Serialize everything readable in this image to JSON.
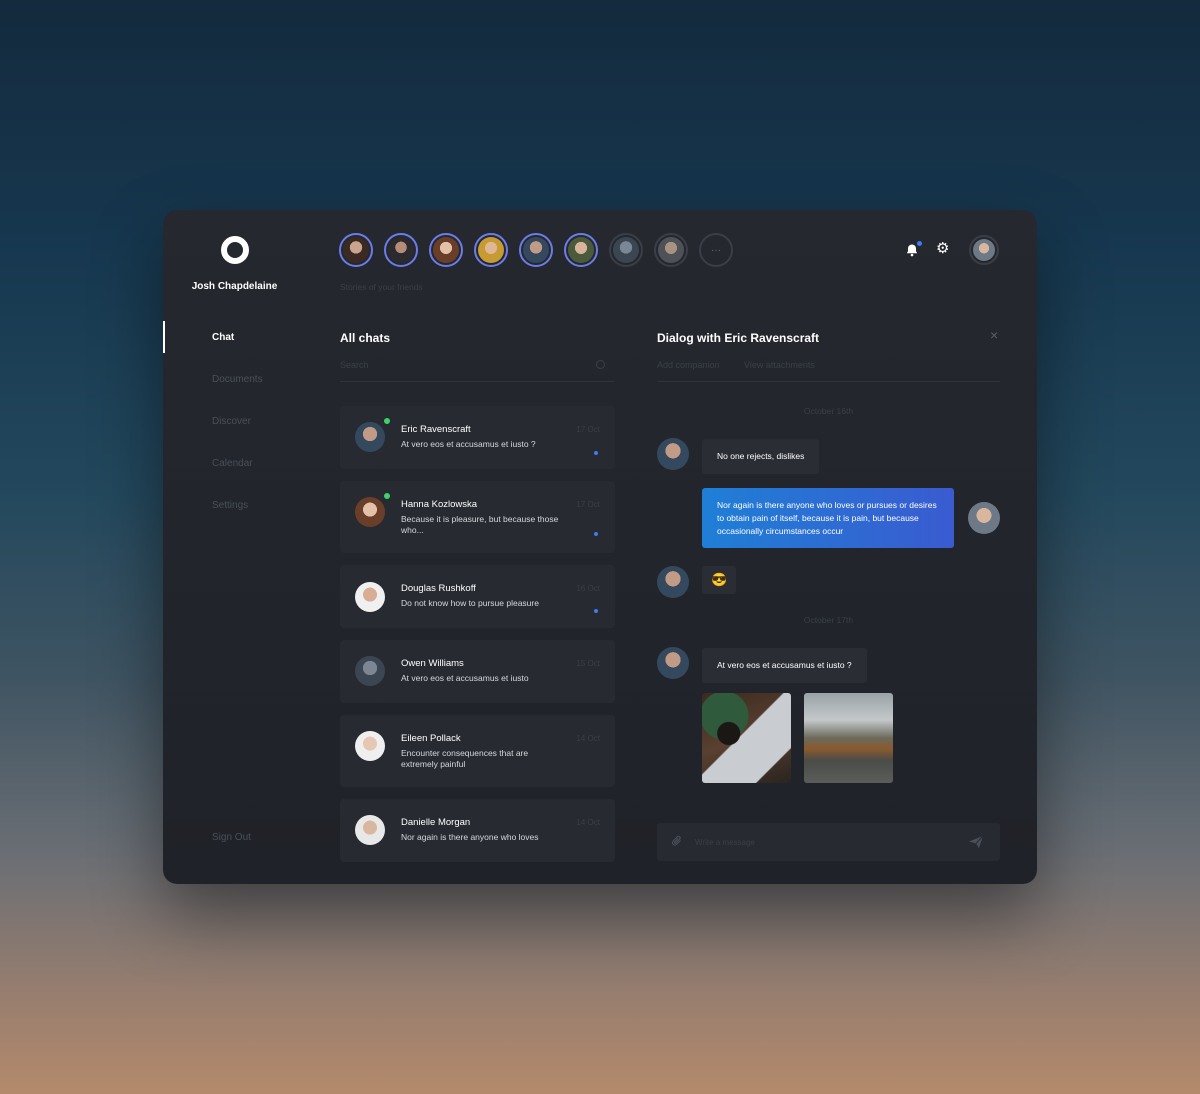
{
  "profile": {
    "name": "Josh Chapdelaine"
  },
  "stories": {
    "caption": "Stories of your friends",
    "more": "···"
  },
  "nav": {
    "items": [
      {
        "label": "Chat"
      },
      {
        "label": "Documents"
      },
      {
        "label": "Discover"
      },
      {
        "label": "Calendar"
      },
      {
        "label": "Settings"
      }
    ],
    "sign_out": "Sign Out"
  },
  "chats": {
    "title": "All chats",
    "search_placeholder": "Search",
    "items": [
      {
        "name": "Eric Ravenscraft",
        "preview": "At vero eos et accusamus et iusto ?",
        "date": "17 Oct",
        "online": true,
        "unread": true
      },
      {
        "name": "Hanna Kozlowska",
        "preview": "Because it is pleasure, but because those who...",
        "date": "17 Oct",
        "online": true,
        "unread": true
      },
      {
        "name": "Douglas Rushkoff",
        "preview": "Do not know how to pursue pleasure",
        "date": "16 Oct",
        "online": false,
        "unread": true
      },
      {
        "name": "Owen Williams",
        "preview": "At vero eos et accusamus et iusto",
        "date": "15 Oct",
        "online": false,
        "unread": false
      },
      {
        "name": "Eileen Pollack",
        "preview": "Encounter consequences that are extremely painful",
        "date": "14 Oct",
        "online": false,
        "unread": false
      },
      {
        "name": "Danielle Morgan",
        "preview": "Nor again is there anyone who loves",
        "date": "14 Oct",
        "online": false,
        "unread": false
      }
    ]
  },
  "dialog": {
    "title": "Dialog with Eric Ravenscraft",
    "actions": {
      "add_companion": "Add companion",
      "view_attachments": "View attachments"
    },
    "close": "×",
    "dates": [
      "October 16th",
      "October 17th"
    ],
    "messages": [
      {
        "text": "No one rejects, dislikes"
      },
      {
        "text": "Nor again is there anyone who loves or pursues or desires to obtain pain of itself, because it is pain, but because occasionally circumstances occur"
      },
      {
        "text": "😎"
      },
      {
        "text": "At vero eos et accusamus et iusto ?"
      }
    ],
    "composer_placeholder": "Write a message"
  },
  "icons": {
    "logo": "ring-logo-icon",
    "bell": "bell-icon",
    "gear": "gear-icon",
    "clip": "paperclip-icon",
    "send": "send-icon"
  },
  "colors": {
    "accent": "#3d7bf0",
    "online": "#3ed36a",
    "story_ring": "#6b7ce8",
    "panel": "#25282f"
  }
}
